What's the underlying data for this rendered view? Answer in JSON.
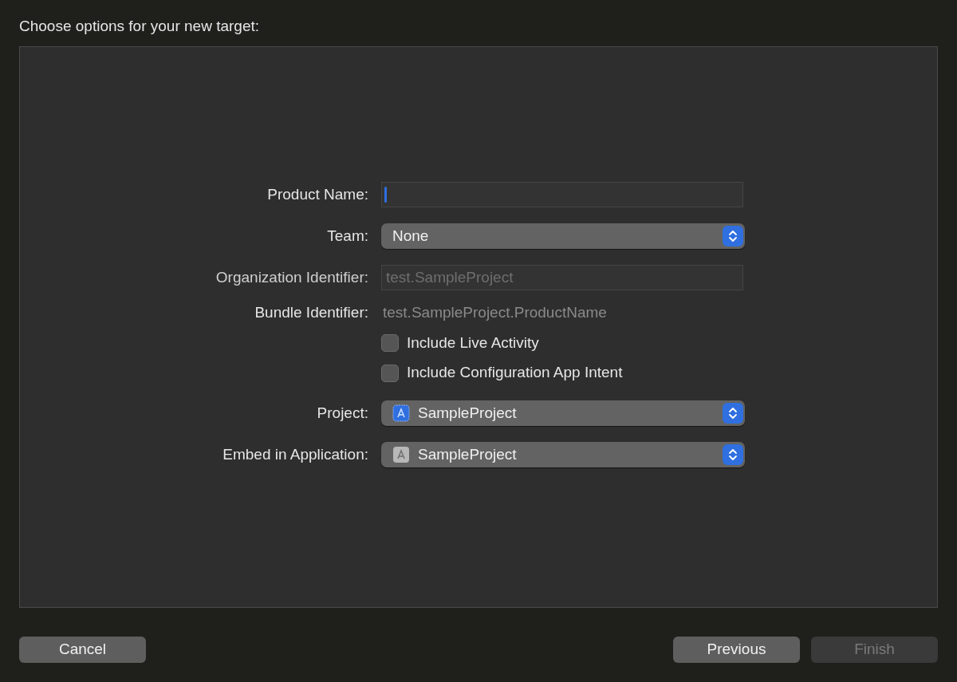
{
  "heading": "Choose options for your new target:",
  "form": [
    {
      "kind": "text",
      "label": "Product Name:",
      "focused": true
    },
    {
      "kind": "popup",
      "label": "Team:",
      "value": "None"
    },
    {
      "kind": "text",
      "label": "Organization Identifier:",
      "placeholder": "test.SampleProject",
      "disabled": true
    },
    {
      "kind": "static",
      "label": "Bundle Identifier:",
      "value": "test.SampleProject.ProductName"
    },
    {
      "kind": "checkbox",
      "label": "Include Live Activity",
      "checked": false
    },
    {
      "kind": "checkbox",
      "label": "Include Configuration App Intent",
      "checked": false
    },
    {
      "kind": "project_popup",
      "label": "Project:",
      "value": "SampleProject"
    },
    {
      "kind": "app_popup",
      "label": "Embed in Application:",
      "value": "SampleProject"
    }
  ],
  "left_buttons": [
    {
      "label": "Cancel",
      "disabled": false
    }
  ],
  "right_buttons": [
    {
      "label": "Previous",
      "disabled": false
    },
    {
      "label": "Finish",
      "disabled": true
    }
  ]
}
